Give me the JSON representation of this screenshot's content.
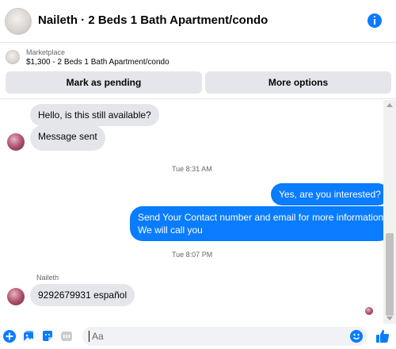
{
  "header": {
    "title": "Naileth · 2 Beds 1 Bath Apartment/condo",
    "info_icon": "info-icon"
  },
  "listing": {
    "source": "Marketplace",
    "description": "$1,300 - 2 Beds 1 Bath Apartment/condo",
    "buttons": {
      "pending": "Mark as pending",
      "more": "More options"
    }
  },
  "messages": {
    "first_in": "Hello, is this still available?",
    "second_in": "Message sent",
    "time_1": "Tue 8:31 AM",
    "out_1": "Yes, are you interested?",
    "out_2_line1": "Send Your Contact number and email for more information",
    "out_2_line2": "We will call you",
    "time_2": "Tue 8:07 PM",
    "sender_name": "Naileth",
    "in_last": "9292679931 español"
  },
  "composer": {
    "placeholder": "Aa",
    "icons": [
      "plus-circle-icon",
      "photo-icon",
      "sticker-icon",
      "gif-icon",
      "emoji-icon",
      "thumbs-up-icon"
    ]
  },
  "colors": {
    "accent": "#0a7cff",
    "incoming_bubble": "#e4e6eb",
    "text_secondary": "#65676b"
  }
}
